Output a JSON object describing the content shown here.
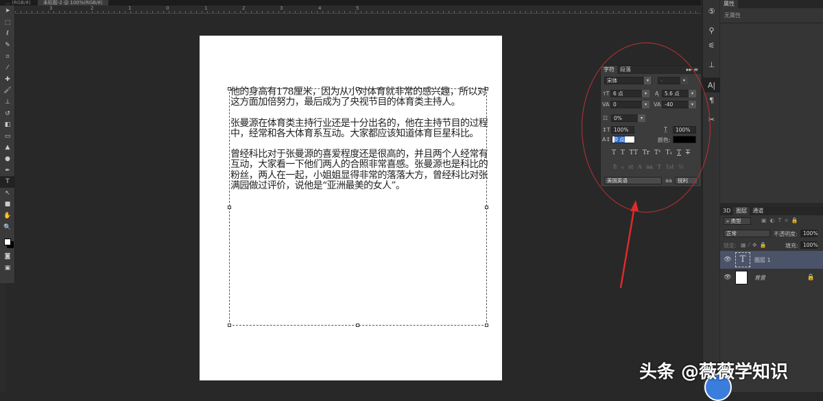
{
  "tabs": [
    {
      "label": "… (RGB/8)"
    },
    {
      "label": "未标题-2 @ 100%(RGB/8)",
      "active": true
    }
  ],
  "ruler_ticks": [
    "3",
    "2",
    "1",
    "0",
    "1",
    "2",
    "3",
    "4",
    "5"
  ],
  "document": {
    "paragraphs": [
      "他的身高有178厘米，因为从小对体育就非常的感兴趣，所以对这方面加倍努力，最后成为了央视节目的体育类主持人。",
      "张曼源在体育类主持行业还是十分出名的，他在主持节目的过程中，经常和各大体育系互动。大家都应该知道体育巨星科比。",
      "曾经科比对于张曼源的喜爱程度还是很高的，并且两个人经常有互动，大家看一下他们两人的合照非常喜感。张曼源也是科比的粉丝，两人在一起，小姐姐显得非常的落落大方，曾经科比对张满园做过评价，说他是“亚洲最美的女人”。"
    ]
  },
  "character_panel": {
    "tabs": [
      "字符",
      "段落"
    ],
    "font_family": "宋体",
    "font_style": "-",
    "font_size": "6 点",
    "leading": "5.6 点",
    "kerning": "0",
    "tracking": "-40",
    "scale_ratio": "0%",
    "vertical_scale": "100%",
    "horizontal_scale": "100%",
    "baseline_shift": "0 点",
    "color_label": "颜色:",
    "color": "#000000",
    "language": "美国英语",
    "aa_label": "aa",
    "antialias": "锐利",
    "styles": [
      "T",
      "T",
      "TT",
      "Tr",
      "T¹",
      "T₁",
      "T",
      "T"
    ],
    "opentype": [
      "fi",
      "ℴ",
      "st",
      "A",
      "aa",
      "T",
      "1st",
      "½"
    ]
  },
  "properties": {
    "tab": "属性",
    "empty": "无属性"
  },
  "layers": {
    "tabs": [
      "3D",
      "图层",
      "通道"
    ],
    "filter": "类型",
    "blend_mode": "正常",
    "opacity_label": "不透明度:",
    "opacity": "100%",
    "lock_label": "锁定:",
    "fill_label": "填充:",
    "fill": "100%",
    "items": [
      {
        "name": "图层 1",
        "type": "text",
        "selected": true
      },
      {
        "name": "背景",
        "type": "background",
        "locked": true
      }
    ]
  },
  "watermark": "头条 @薇薇学知识",
  "colors": {
    "annotation": "#c23030",
    "selected_layer": "#4a5368"
  }
}
